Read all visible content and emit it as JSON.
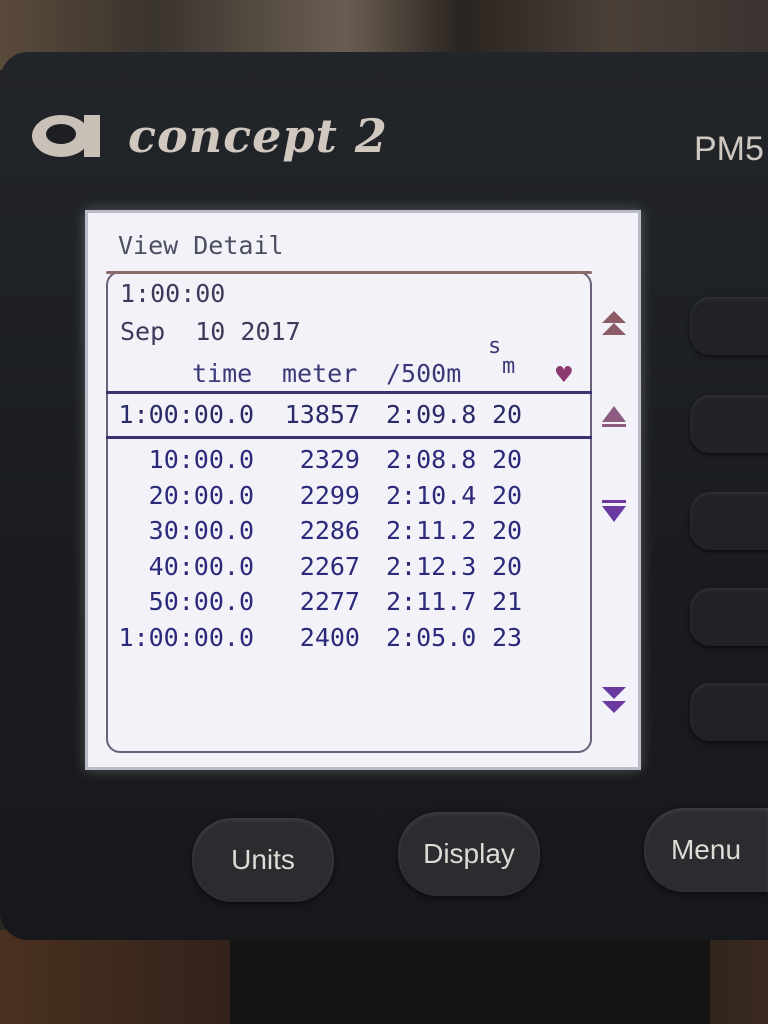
{
  "brand": {
    "logo_text": "concept 2",
    "model": "PM5"
  },
  "screen": {
    "title": "View Detail",
    "workout_duration": "1:00:00",
    "date": "Sep  10 2017",
    "columns": {
      "time": "time",
      "meter": "meter",
      "pace": "/500m",
      "spm_top": "s",
      "spm_bottom": "m",
      "heart_icon": "heart-icon"
    },
    "summary": {
      "time": "1:00:00.0",
      "meter": "13857",
      "pace": "2:09.8",
      "spm": "20"
    },
    "splits": [
      {
        "time": "10:00.0",
        "meter": "2329",
        "pace": "2:08.8",
        "spm": "20"
      },
      {
        "time": "20:00.0",
        "meter": "2299",
        "pace": "2:10.4",
        "spm": "20"
      },
      {
        "time": "30:00.0",
        "meter": "2286",
        "pace": "2:11.2",
        "spm": "20"
      },
      {
        "time": "40:00.0",
        "meter": "2267",
        "pace": "2:12.3",
        "spm": "20"
      },
      {
        "time": "50:00.0",
        "meter": "2277",
        "pace": "2:11.7",
        "spm": "21"
      },
      {
        "time": "1:00:00.0",
        "meter": "2400",
        "pace": "2:05.0",
        "spm": "23"
      }
    ]
  },
  "buttons": {
    "units": "Units",
    "display": "Display",
    "menu": "Menu"
  },
  "colors": {
    "screen_bg": "#f3f2f8",
    "text": "#2c2a7a",
    "bezel": "#1b1d21"
  }
}
